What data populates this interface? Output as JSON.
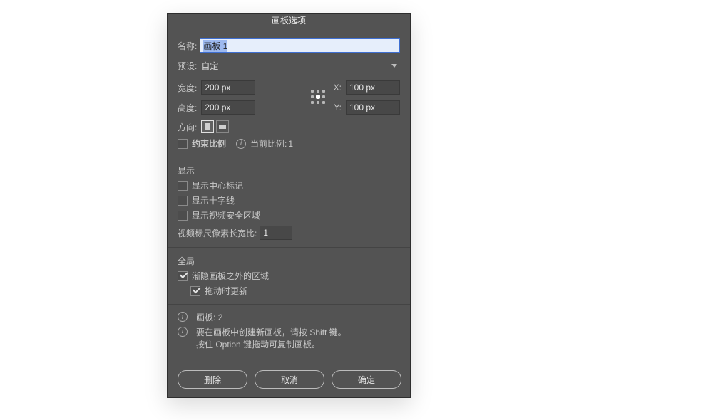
{
  "title": "画板选项",
  "name": {
    "label": "名称:",
    "value": "画板 1"
  },
  "preset": {
    "label": "预设:",
    "value": "自定"
  },
  "dims": {
    "width_label": "宽度:",
    "width_value": "200 px",
    "height_label": "高度:",
    "height_value": "200 px",
    "x_label": "X:",
    "x_value": "100 px",
    "y_label": "Y:",
    "y_value": "100 px"
  },
  "orientation": {
    "label": "方向:"
  },
  "constrain": {
    "label": "约束比例",
    "ratio_label": "当前比例:",
    "ratio_value": "1",
    "checked": false
  },
  "display": {
    "section": "显示",
    "center": {
      "label": "显示中心标记",
      "checked": false
    },
    "cross": {
      "label": "显示十字线",
      "checked": false
    },
    "safe": {
      "label": "显示视频安全区域",
      "checked": false
    },
    "par": {
      "label": "视频标尺像素长宽比:",
      "value": "1"
    }
  },
  "global": {
    "section": "全局",
    "fade": {
      "label": "渐隐画板之外的区域",
      "checked": true
    },
    "drag": {
      "label": "拖动时更新",
      "checked": true
    }
  },
  "info": {
    "count_label": "画板:",
    "count_value": "2",
    "hint1": "要在画板中创建新画板，请按 Shift 键。",
    "hint2": "按住 Option 键拖动可复制画板。"
  },
  "buttons": {
    "delete": "删除",
    "cancel": "取消",
    "ok": "确定"
  }
}
